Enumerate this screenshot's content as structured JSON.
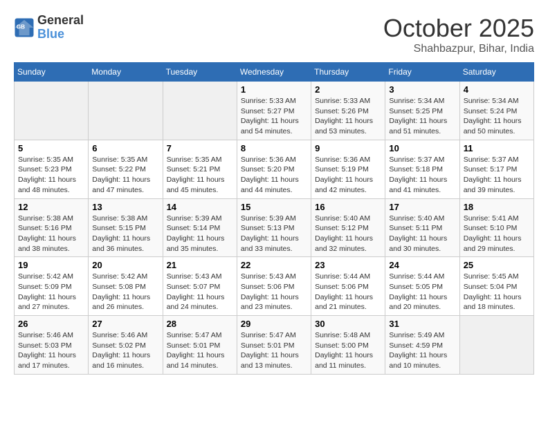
{
  "header": {
    "logo_line1": "General",
    "logo_line2": "Blue",
    "month": "October 2025",
    "location": "Shahbazpur, Bihar, India"
  },
  "weekdays": [
    "Sunday",
    "Monday",
    "Tuesday",
    "Wednesday",
    "Thursday",
    "Friday",
    "Saturday"
  ],
  "weeks": [
    [
      {
        "day": "",
        "info": ""
      },
      {
        "day": "",
        "info": ""
      },
      {
        "day": "",
        "info": ""
      },
      {
        "day": "1",
        "info": "Sunrise: 5:33 AM\nSunset: 5:27 PM\nDaylight: 11 hours\nand 54 minutes."
      },
      {
        "day": "2",
        "info": "Sunrise: 5:33 AM\nSunset: 5:26 PM\nDaylight: 11 hours\nand 53 minutes."
      },
      {
        "day": "3",
        "info": "Sunrise: 5:34 AM\nSunset: 5:25 PM\nDaylight: 11 hours\nand 51 minutes."
      },
      {
        "day": "4",
        "info": "Sunrise: 5:34 AM\nSunset: 5:24 PM\nDaylight: 11 hours\nand 50 minutes."
      }
    ],
    [
      {
        "day": "5",
        "info": "Sunrise: 5:35 AM\nSunset: 5:23 PM\nDaylight: 11 hours\nand 48 minutes."
      },
      {
        "day": "6",
        "info": "Sunrise: 5:35 AM\nSunset: 5:22 PM\nDaylight: 11 hours\nand 47 minutes."
      },
      {
        "day": "7",
        "info": "Sunrise: 5:35 AM\nSunset: 5:21 PM\nDaylight: 11 hours\nand 45 minutes."
      },
      {
        "day": "8",
        "info": "Sunrise: 5:36 AM\nSunset: 5:20 PM\nDaylight: 11 hours\nand 44 minutes."
      },
      {
        "day": "9",
        "info": "Sunrise: 5:36 AM\nSunset: 5:19 PM\nDaylight: 11 hours\nand 42 minutes."
      },
      {
        "day": "10",
        "info": "Sunrise: 5:37 AM\nSunset: 5:18 PM\nDaylight: 11 hours\nand 41 minutes."
      },
      {
        "day": "11",
        "info": "Sunrise: 5:37 AM\nSunset: 5:17 PM\nDaylight: 11 hours\nand 39 minutes."
      }
    ],
    [
      {
        "day": "12",
        "info": "Sunrise: 5:38 AM\nSunset: 5:16 PM\nDaylight: 11 hours\nand 38 minutes."
      },
      {
        "day": "13",
        "info": "Sunrise: 5:38 AM\nSunset: 5:15 PM\nDaylight: 11 hours\nand 36 minutes."
      },
      {
        "day": "14",
        "info": "Sunrise: 5:39 AM\nSunset: 5:14 PM\nDaylight: 11 hours\nand 35 minutes."
      },
      {
        "day": "15",
        "info": "Sunrise: 5:39 AM\nSunset: 5:13 PM\nDaylight: 11 hours\nand 33 minutes."
      },
      {
        "day": "16",
        "info": "Sunrise: 5:40 AM\nSunset: 5:12 PM\nDaylight: 11 hours\nand 32 minutes."
      },
      {
        "day": "17",
        "info": "Sunrise: 5:40 AM\nSunset: 5:11 PM\nDaylight: 11 hours\nand 30 minutes."
      },
      {
        "day": "18",
        "info": "Sunrise: 5:41 AM\nSunset: 5:10 PM\nDaylight: 11 hours\nand 29 minutes."
      }
    ],
    [
      {
        "day": "19",
        "info": "Sunrise: 5:42 AM\nSunset: 5:09 PM\nDaylight: 11 hours\nand 27 minutes."
      },
      {
        "day": "20",
        "info": "Sunrise: 5:42 AM\nSunset: 5:08 PM\nDaylight: 11 hours\nand 26 minutes."
      },
      {
        "day": "21",
        "info": "Sunrise: 5:43 AM\nSunset: 5:07 PM\nDaylight: 11 hours\nand 24 minutes."
      },
      {
        "day": "22",
        "info": "Sunrise: 5:43 AM\nSunset: 5:06 PM\nDaylight: 11 hours\nand 23 minutes."
      },
      {
        "day": "23",
        "info": "Sunrise: 5:44 AM\nSunset: 5:06 PM\nDaylight: 11 hours\nand 21 minutes."
      },
      {
        "day": "24",
        "info": "Sunrise: 5:44 AM\nSunset: 5:05 PM\nDaylight: 11 hours\nand 20 minutes."
      },
      {
        "day": "25",
        "info": "Sunrise: 5:45 AM\nSunset: 5:04 PM\nDaylight: 11 hours\nand 18 minutes."
      }
    ],
    [
      {
        "day": "26",
        "info": "Sunrise: 5:46 AM\nSunset: 5:03 PM\nDaylight: 11 hours\nand 17 minutes."
      },
      {
        "day": "27",
        "info": "Sunrise: 5:46 AM\nSunset: 5:02 PM\nDaylight: 11 hours\nand 16 minutes."
      },
      {
        "day": "28",
        "info": "Sunrise: 5:47 AM\nSunset: 5:01 PM\nDaylight: 11 hours\nand 14 minutes."
      },
      {
        "day": "29",
        "info": "Sunrise: 5:47 AM\nSunset: 5:01 PM\nDaylight: 11 hours\nand 13 minutes."
      },
      {
        "day": "30",
        "info": "Sunrise: 5:48 AM\nSunset: 5:00 PM\nDaylight: 11 hours\nand 11 minutes."
      },
      {
        "day": "31",
        "info": "Sunrise: 5:49 AM\nSunset: 4:59 PM\nDaylight: 11 hours\nand 10 minutes."
      },
      {
        "day": "",
        "info": ""
      }
    ]
  ]
}
